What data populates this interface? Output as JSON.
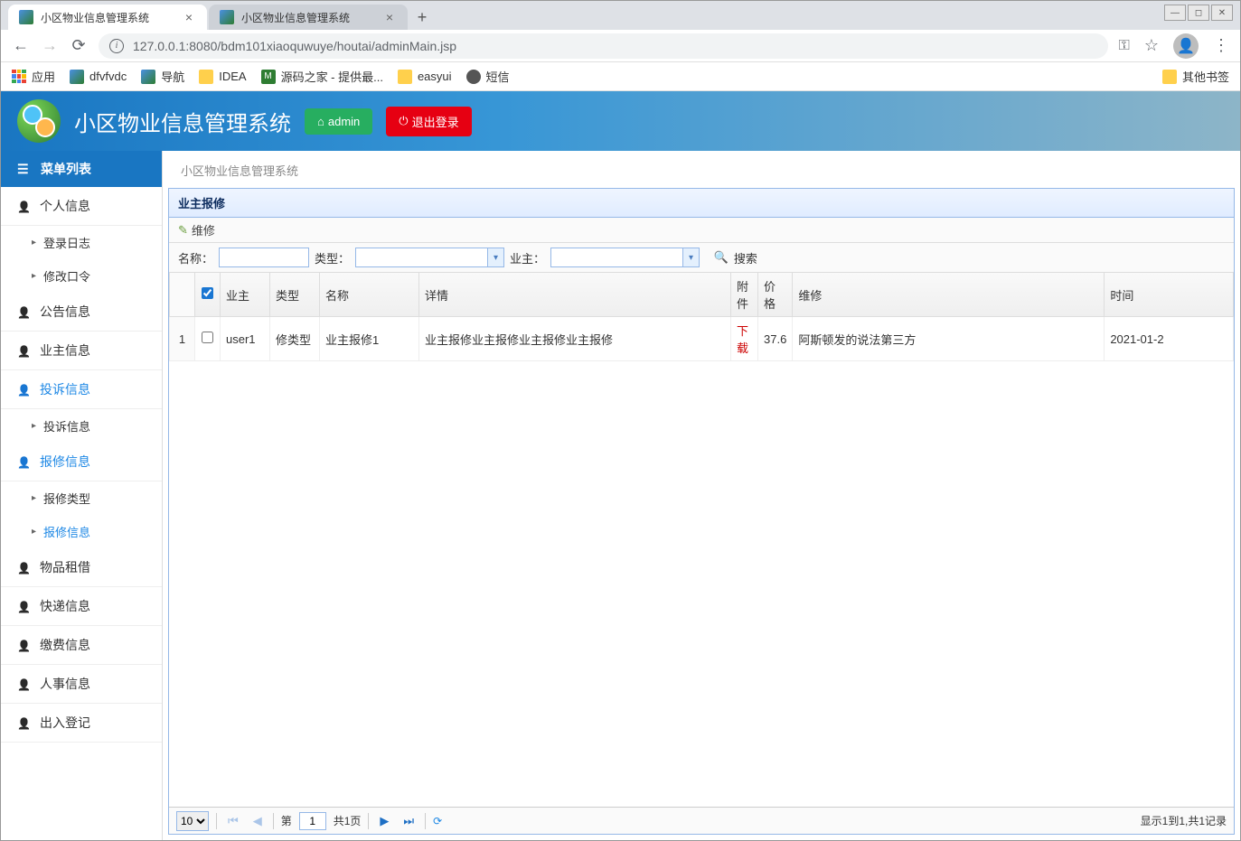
{
  "browser": {
    "tabs": [
      {
        "title": "小区物业信息管理系统",
        "active": true
      },
      {
        "title": "小区物业信息管理系统",
        "active": false
      }
    ],
    "url": "127.0.0.1:8080/bdm101xiaoquwuye/houtai/adminMain.jsp",
    "bookmarks": {
      "apps_label": "应用",
      "items": [
        "dfvfvdc",
        "导航",
        "IDEA",
        "源码之家 - 提供最...",
        "easyui",
        "短信"
      ],
      "other_label": "其他书签"
    }
  },
  "header": {
    "title": "小区物业信息管理系统",
    "admin_label": "admin",
    "logout_label": "退出登录"
  },
  "sidebar": {
    "header": "菜单列表",
    "items": [
      {
        "label": "个人信息",
        "active": false,
        "subs": [
          {
            "label": "登录日志",
            "active": false
          },
          {
            "label": "修改口令",
            "active": false
          }
        ]
      },
      {
        "label": "公告信息",
        "active": false,
        "subs": []
      },
      {
        "label": "业主信息",
        "active": false,
        "subs": []
      },
      {
        "label": "投诉信息",
        "active": true,
        "subs": [
          {
            "label": "投诉信息",
            "active": false
          }
        ]
      },
      {
        "label": "报修信息",
        "active": true,
        "subs": [
          {
            "label": "报修类型",
            "active": false
          },
          {
            "label": "报修信息",
            "active": true
          }
        ]
      },
      {
        "label": "物品租借",
        "active": false,
        "subs": []
      },
      {
        "label": "快递信息",
        "active": false,
        "subs": []
      },
      {
        "label": "缴费信息",
        "active": false,
        "subs": []
      },
      {
        "label": "人事信息",
        "active": false,
        "subs": []
      },
      {
        "label": "出入登记",
        "active": false,
        "subs": []
      }
    ]
  },
  "breadcrumb": "小区物业信息管理系统",
  "panel": {
    "title": "业主报修",
    "toolbar": {
      "edit_label": "维修"
    },
    "search": {
      "name_label": "名称：",
      "type_label": "类型：",
      "owner_label": "业主：",
      "search_label": "搜索"
    },
    "columns": [
      "",
      "",
      "业主",
      "类型",
      "名称",
      "详情",
      "附件",
      "价格",
      "维修",
      "时间"
    ],
    "rows": [
      {
        "rn": "1",
        "owner": "user1",
        "type": "修类型",
        "name": "业主报修1",
        "detail": "业主报修业主报修业主报修业主报修",
        "attach": "下载",
        "price": "37.6",
        "repair": "阿斯顿发的说法第三方",
        "time": "2021-01-2"
      }
    ]
  },
  "pager": {
    "page_size": "10",
    "page_prefix": "第",
    "page_value": "1",
    "page_total": "共1页",
    "info": "显示1到1,共1记录"
  }
}
